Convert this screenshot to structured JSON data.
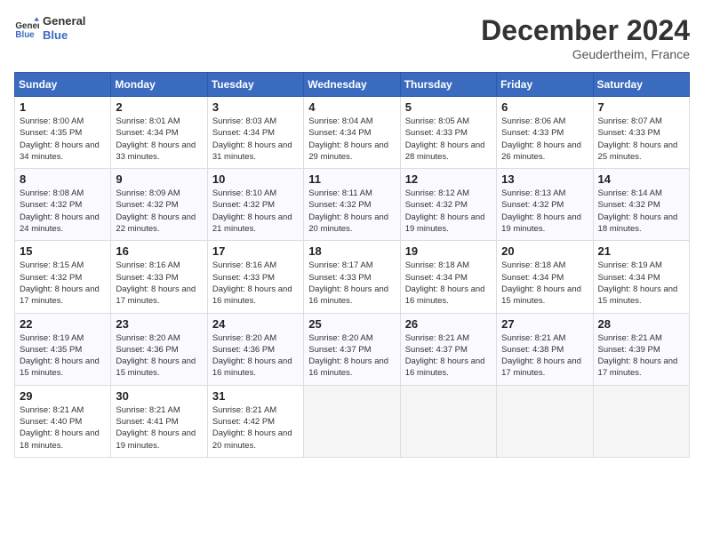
{
  "header": {
    "logo_line1": "General",
    "logo_line2": "Blue",
    "month_title": "December 2024",
    "location": "Geudertheim, France"
  },
  "weekdays": [
    "Sunday",
    "Monday",
    "Tuesday",
    "Wednesday",
    "Thursday",
    "Friday",
    "Saturday"
  ],
  "weeks": [
    [
      {
        "day": "1",
        "sunrise": "8:00 AM",
        "sunset": "4:35 PM",
        "daylight": "8 hours and 34 minutes"
      },
      {
        "day": "2",
        "sunrise": "8:01 AM",
        "sunset": "4:34 PM",
        "daylight": "8 hours and 33 minutes"
      },
      {
        "day": "3",
        "sunrise": "8:03 AM",
        "sunset": "4:34 PM",
        "daylight": "8 hours and 31 minutes"
      },
      {
        "day": "4",
        "sunrise": "8:04 AM",
        "sunset": "4:34 PM",
        "daylight": "8 hours and 29 minutes"
      },
      {
        "day": "5",
        "sunrise": "8:05 AM",
        "sunset": "4:33 PM",
        "daylight": "8 hours and 28 minutes"
      },
      {
        "day": "6",
        "sunrise": "8:06 AM",
        "sunset": "4:33 PM",
        "daylight": "8 hours and 26 minutes"
      },
      {
        "day": "7",
        "sunrise": "8:07 AM",
        "sunset": "4:33 PM",
        "daylight": "8 hours and 25 minutes"
      }
    ],
    [
      {
        "day": "8",
        "sunrise": "8:08 AM",
        "sunset": "4:32 PM",
        "daylight": "8 hours and 24 minutes"
      },
      {
        "day": "9",
        "sunrise": "8:09 AM",
        "sunset": "4:32 PM",
        "daylight": "8 hours and 22 minutes"
      },
      {
        "day": "10",
        "sunrise": "8:10 AM",
        "sunset": "4:32 PM",
        "daylight": "8 hours and 21 minutes"
      },
      {
        "day": "11",
        "sunrise": "8:11 AM",
        "sunset": "4:32 PM",
        "daylight": "8 hours and 20 minutes"
      },
      {
        "day": "12",
        "sunrise": "8:12 AM",
        "sunset": "4:32 PM",
        "daylight": "8 hours and 19 minutes"
      },
      {
        "day": "13",
        "sunrise": "8:13 AM",
        "sunset": "4:32 PM",
        "daylight": "8 hours and 19 minutes"
      },
      {
        "day": "14",
        "sunrise": "8:14 AM",
        "sunset": "4:32 PM",
        "daylight": "8 hours and 18 minutes"
      }
    ],
    [
      {
        "day": "15",
        "sunrise": "8:15 AM",
        "sunset": "4:32 PM",
        "daylight": "8 hours and 17 minutes"
      },
      {
        "day": "16",
        "sunrise": "8:16 AM",
        "sunset": "4:33 PM",
        "daylight": "8 hours and 17 minutes"
      },
      {
        "day": "17",
        "sunrise": "8:16 AM",
        "sunset": "4:33 PM",
        "daylight": "8 hours and 16 minutes"
      },
      {
        "day": "18",
        "sunrise": "8:17 AM",
        "sunset": "4:33 PM",
        "daylight": "8 hours and 16 minutes"
      },
      {
        "day": "19",
        "sunrise": "8:18 AM",
        "sunset": "4:34 PM",
        "daylight": "8 hours and 16 minutes"
      },
      {
        "day": "20",
        "sunrise": "8:18 AM",
        "sunset": "4:34 PM",
        "daylight": "8 hours and 15 minutes"
      },
      {
        "day": "21",
        "sunrise": "8:19 AM",
        "sunset": "4:34 PM",
        "daylight": "8 hours and 15 minutes"
      }
    ],
    [
      {
        "day": "22",
        "sunrise": "8:19 AM",
        "sunset": "4:35 PM",
        "daylight": "8 hours and 15 minutes"
      },
      {
        "day": "23",
        "sunrise": "8:20 AM",
        "sunset": "4:36 PM",
        "daylight": "8 hours and 15 minutes"
      },
      {
        "day": "24",
        "sunrise": "8:20 AM",
        "sunset": "4:36 PM",
        "daylight": "8 hours and 16 minutes"
      },
      {
        "day": "25",
        "sunrise": "8:20 AM",
        "sunset": "4:37 PM",
        "daylight": "8 hours and 16 minutes"
      },
      {
        "day": "26",
        "sunrise": "8:21 AM",
        "sunset": "4:37 PM",
        "daylight": "8 hours and 16 minutes"
      },
      {
        "day": "27",
        "sunrise": "8:21 AM",
        "sunset": "4:38 PM",
        "daylight": "8 hours and 17 minutes"
      },
      {
        "day": "28",
        "sunrise": "8:21 AM",
        "sunset": "4:39 PM",
        "daylight": "8 hours and 17 minutes"
      }
    ],
    [
      {
        "day": "29",
        "sunrise": "8:21 AM",
        "sunset": "4:40 PM",
        "daylight": "8 hours and 18 minutes"
      },
      {
        "day": "30",
        "sunrise": "8:21 AM",
        "sunset": "4:41 PM",
        "daylight": "8 hours and 19 minutes"
      },
      {
        "day": "31",
        "sunrise": "8:21 AM",
        "sunset": "4:42 PM",
        "daylight": "8 hours and 20 minutes"
      },
      null,
      null,
      null,
      null
    ]
  ]
}
